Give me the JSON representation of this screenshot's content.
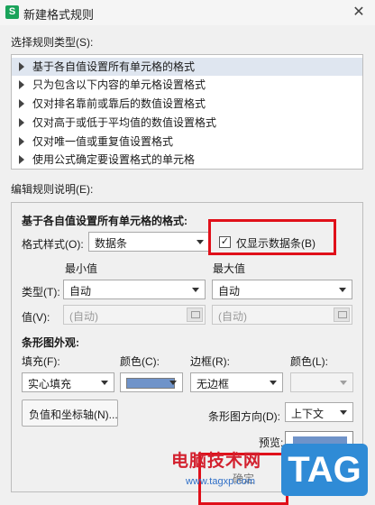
{
  "window": {
    "title": "新建格式规则",
    "app_badge": "S"
  },
  "rule_type": {
    "label": "选择规则类型(S):",
    "items": [
      {
        "text": "基于各自值设置所有单元格的格式",
        "selected": true
      },
      {
        "text": "只为包含以下内容的单元格设置格式",
        "selected": false
      },
      {
        "text": "仅对排名靠前或靠后的数值设置格式",
        "selected": false
      },
      {
        "text": "仅对高于或低于平均值的数值设置格式",
        "selected": false
      },
      {
        "text": "仅对唯一值或重复值设置格式",
        "selected": false
      },
      {
        "text": "使用公式确定要设置格式的单元格",
        "selected": false
      }
    ]
  },
  "description": {
    "label": "编辑规则说明(E):",
    "heading": "基于各自值设置所有单元格的格式:",
    "format_style": {
      "label": "格式样式(O):",
      "value": "数据条"
    },
    "show_bar_only": {
      "label": "仅显示数据条(B)",
      "checked": true,
      "check_glyph": "✓"
    },
    "min_label": "最小值",
    "max_label": "最大值",
    "type_label": "类型(T):",
    "min_type": "自动",
    "max_type": "自动",
    "value_label": "值(V):",
    "min_value": "(自动)",
    "max_value": "(自动)",
    "bar_appearance": "条形图外观:",
    "fill_label": "填充(F):",
    "fill_value": "实心填充",
    "color_label": "颜色(C):",
    "bar_color": "#6f93c9",
    "border_label": "边框(R):",
    "border_value": "无边框",
    "border_color_label": "颜色(L):",
    "neg_axis_button": "负值和坐标轴(N)...",
    "direction_label": "条形图方向(D):",
    "direction_value": "上下文",
    "preview_label": "预览:",
    "hidden_button": "确定"
  },
  "watermark": {
    "site_name": "电脑技术网",
    "url": "www.tagxp.com",
    "badge": "TAG"
  }
}
